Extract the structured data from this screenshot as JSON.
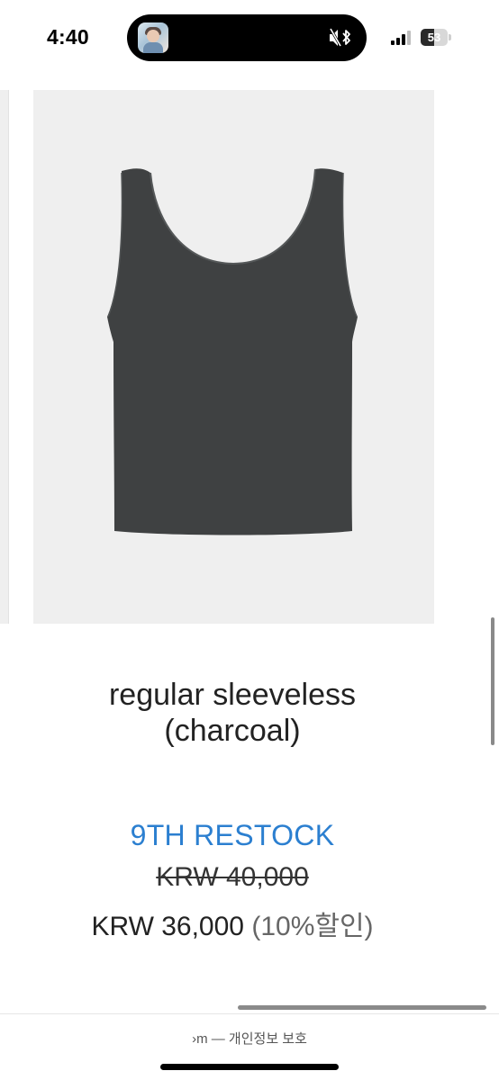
{
  "status_bar": {
    "time": "4:40",
    "battery_level": "53",
    "icons": [
      "mute-bell-icon",
      "bluetooth-icon",
      "cellular-signal-icon",
      "battery-icon"
    ]
  },
  "product": {
    "title_line1": "regular sleeveless",
    "title_line2": "(charcoal)",
    "restock_label": "9TH RESTOCK",
    "original_price": "KRW 40,000",
    "sale_price": "KRW 36,000",
    "discount_note": "(10%할인)",
    "image_color": "#3f4142"
  },
  "footer": {
    "text": "›m — 개인정보 보호"
  },
  "colors": {
    "accent_blue": "#2b7fd0",
    "image_background": "#efefef"
  }
}
